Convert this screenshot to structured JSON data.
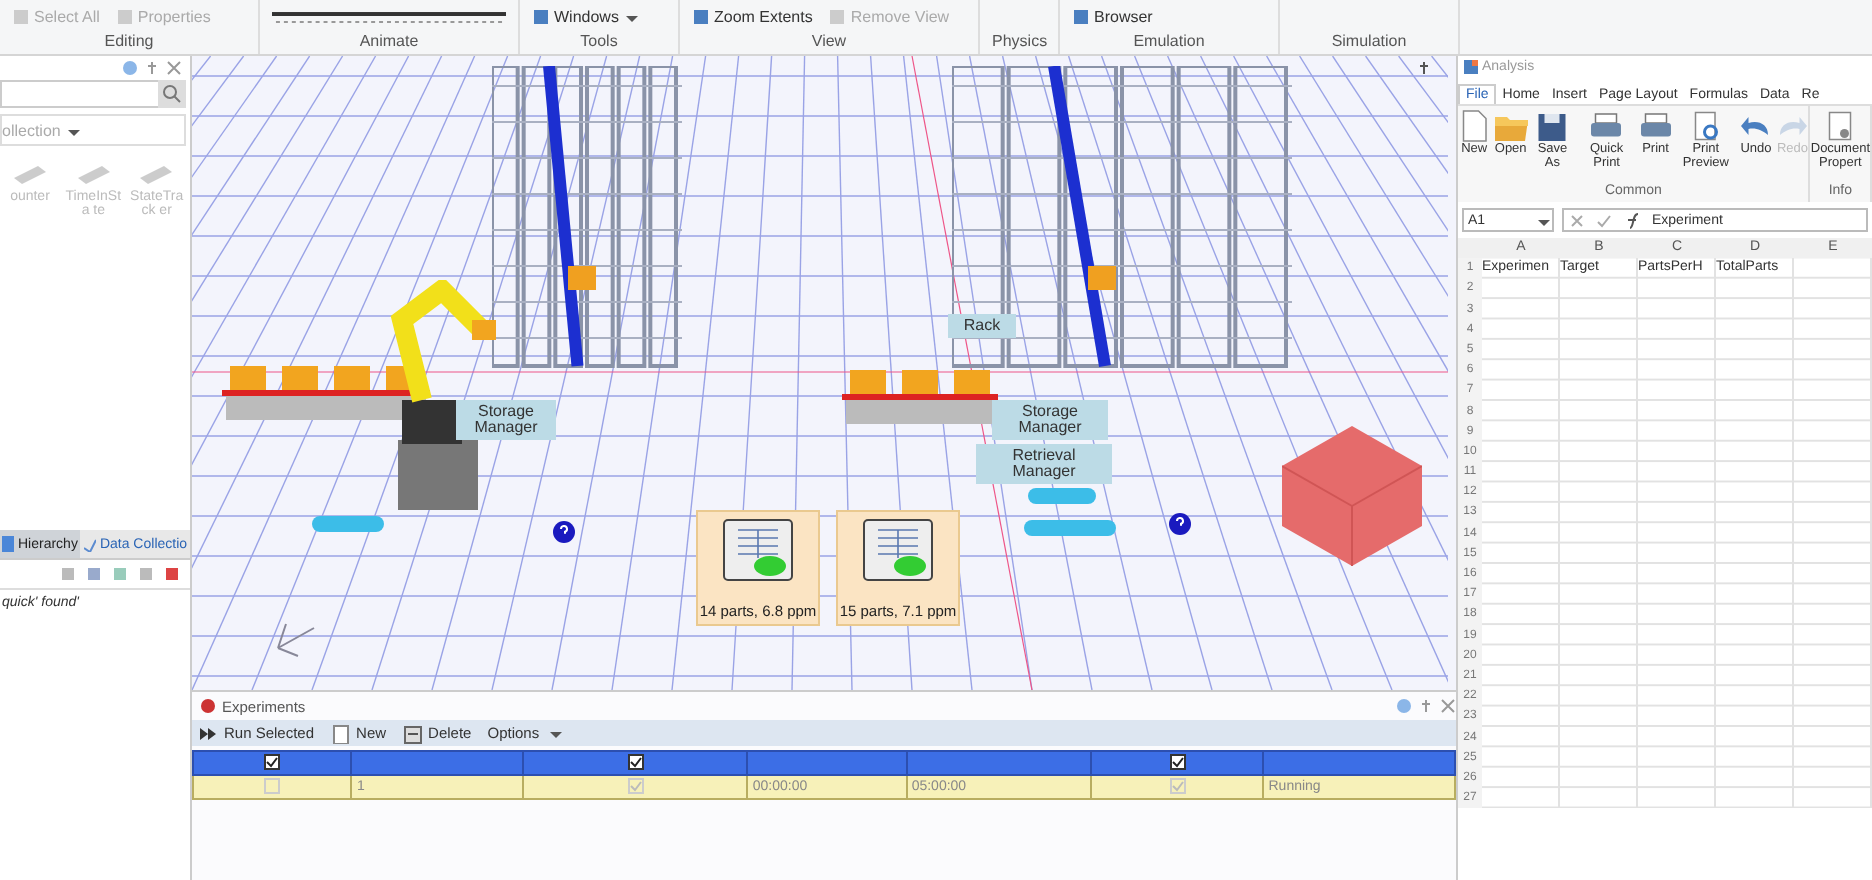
{
  "ribbon": {
    "groups": [
      {
        "label": "Editing",
        "buttons": [
          {
            "label": "Select All",
            "disabled": true,
            "dropdown": false
          },
          {
            "label": "Properties",
            "disabled": true,
            "dropdown": false
          }
        ]
      },
      {
        "label": "Animate"
      },
      {
        "label": "Tools",
        "buttons": [
          {
            "label": "Windows",
            "disabled": false,
            "dropdown": true
          }
        ]
      },
      {
        "label": "View",
        "buttons": [
          {
            "label": "Zoom Extents",
            "disabled": false,
            "dropdown": false
          },
          {
            "label": "Remove View",
            "disabled": true,
            "dropdown": false
          }
        ]
      },
      {
        "label": "Physics"
      },
      {
        "label": "Emulation",
        "buttons": [
          {
            "label": "Browser",
            "disabled": false,
            "dropdown": false
          }
        ]
      },
      {
        "label": "Simulation"
      }
    ]
  },
  "left_panel": {
    "library_dropdown": "ollection",
    "library_items": [
      "ounter",
      "TimeInSta te",
      "StateTrack er"
    ],
    "tabs": [
      {
        "label": "Hierarchy",
        "selected": true
      },
      {
        "label": "Data Collectio",
        "selected": false
      }
    ],
    "console_text": "quick' found'"
  },
  "view": {
    "signs": [
      {
        "label": "Storage Manager"
      },
      {
        "label": "Rack"
      },
      {
        "label": "Storage Manager"
      },
      {
        "label": "Retrieval Manager"
      }
    ],
    "cards": [
      {
        "caption": "14 parts, 6.8 ppm"
      },
      {
        "caption": "15 parts, 7.1 ppm"
      }
    ]
  },
  "experiments": {
    "title": "Experiments",
    "toolbar": [
      {
        "label": "Run Selected"
      },
      {
        "label": "New"
      },
      {
        "label": "Delete"
      },
      {
        "label": "Options"
      }
    ],
    "header": [
      {
        "kind": "check",
        "checked": true
      },
      {
        "kind": "blank"
      },
      {
        "kind": "check",
        "checked": true
      },
      {
        "kind": "blank"
      },
      {
        "kind": "blank"
      },
      {
        "kind": "check",
        "checked": true
      },
      {
        "kind": "blank"
      }
    ],
    "rows": [
      {
        "cells": [
          {
            "kind": "check",
            "checked": false
          },
          {
            "kind": "text",
            "text": "1"
          },
          {
            "kind": "check",
            "checked": true
          },
          {
            "kind": "text",
            "text": "00:00:00"
          },
          {
            "kind": "text",
            "text": "05:00:00"
          },
          {
            "kind": "check",
            "checked": true
          },
          {
            "kind": "text",
            "text": "Running"
          }
        ]
      }
    ]
  },
  "sheet": {
    "title": "Analysis",
    "tabs": [
      {
        "label": "File",
        "selected": true
      },
      {
        "label": "Home",
        "selected": false
      },
      {
        "label": "Insert",
        "selected": false
      },
      {
        "label": "Page Layout",
        "selected": false
      },
      {
        "label": "Formulas",
        "selected": false
      },
      {
        "label": "Data",
        "selected": false
      },
      {
        "label": "Re",
        "selected": false
      }
    ],
    "buttons": [
      {
        "label": "New",
        "disabled": false
      },
      {
        "label": "Open",
        "disabled": false
      },
      {
        "label": "Save As",
        "disabled": false
      },
      {
        "label": "Quick Print",
        "disabled": false
      },
      {
        "label": "Print",
        "disabled": false
      },
      {
        "label": "Print Preview",
        "disabled": false
      },
      {
        "label": "Undo",
        "disabled": false
      },
      {
        "label": "Redo",
        "disabled": true
      },
      {
        "label": "Document Propert",
        "disabled": false
      }
    ],
    "groups": [
      "Common",
      "Info"
    ],
    "name_box": "A1",
    "formula": "Experiment",
    "columns": [
      "A",
      "B",
      "C",
      "D",
      "E"
    ],
    "rows": [
      {
        "number": "1",
        "cells": [
          "Experimen",
          "Target",
          "PartsPerH",
          "TotalParts"
        ]
      },
      {
        "number": "2"
      },
      {
        "number": "3"
      },
      {
        "number": "4"
      },
      {
        "number": "5"
      },
      {
        "number": "6"
      },
      {
        "number": "7"
      },
      {
        "number": "8"
      },
      {
        "number": "9"
      },
      {
        "number": "10"
      },
      {
        "number": "11"
      },
      {
        "number": "12"
      },
      {
        "number": "13"
      },
      {
        "number": "14"
      },
      {
        "number": "15"
      },
      {
        "number": "16"
      },
      {
        "number": "17"
      },
      {
        "number": "18"
      },
      {
        "number": "19"
      },
      {
        "number": "20"
      },
      {
        "number": "21"
      },
      {
        "number": "22"
      },
      {
        "number": "23"
      },
      {
        "number": "24"
      },
      {
        "number": "25"
      },
      {
        "number": "26"
      },
      {
        "number": "27"
      }
    ]
  }
}
